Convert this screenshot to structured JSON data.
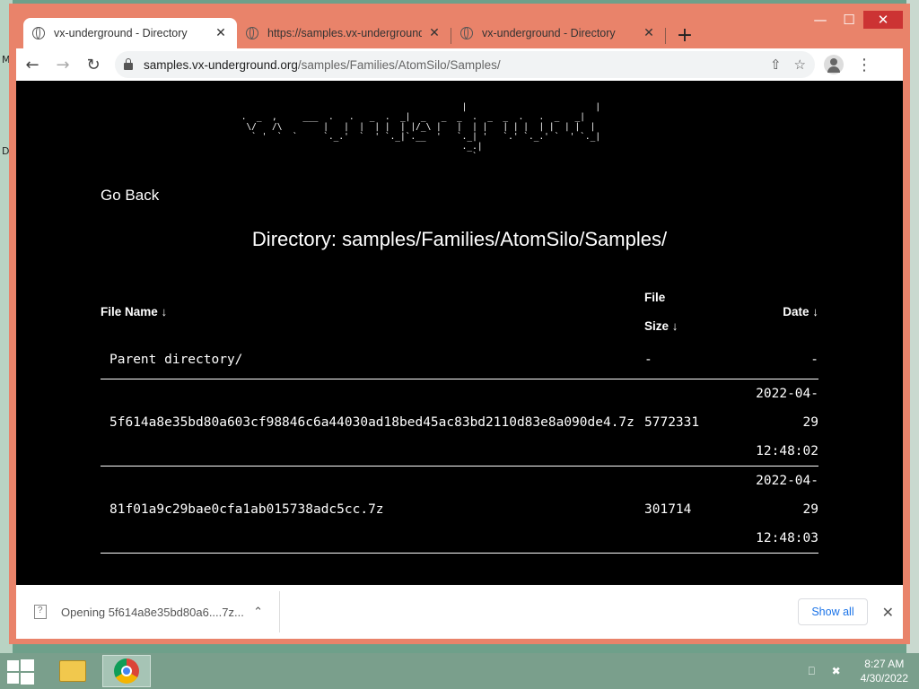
{
  "desktop": {
    "left_glyphs": [
      "M",
      "D"
    ]
  },
  "window_controls": {
    "minimize": "—",
    "maximize": "☐",
    "close": "✕"
  },
  "tabs": [
    {
      "title": "vx-underground - Directory",
      "close": "✕",
      "active": true
    },
    {
      "title": "https://samples.vx-underground.",
      "close": "✕",
      "active": false
    },
    {
      "title": "vx-underground - Directory",
      "close": "✕",
      "active": false
    }
  ],
  "new_tab": "+",
  "toolbar": {
    "back": "←",
    "forward": "→",
    "reload": "↻",
    "url_host": "samples.vx-underground.org",
    "url_path": "/samples/Families/AtomSilo/Samples/",
    "share_icon": "⇧",
    "star_icon": "☆",
    "menu": "⋮"
  },
  "page": {
    "ascii_logo": "                                            |                         |\n .  _  ,     ___  .   .   _  .  _|  _   _  _  .  _  _  .   .  _   _|\n  \\/   /\\        |   |  |  | |  | |/_\\ |   |  | |   | | |  | |  | |  |\n   ` '  `  `     `._.'  `  ' `._|`.__  '   `._| '   `.' `._.' `  ' `._|\n                                            ._.|\n                                              `",
    "go_back": "Go Back",
    "directory_label": "Directory: samples/Families/AtomSilo/Samples/",
    "table": {
      "headers": {
        "name": "File Name  ↓",
        "size_line1": "File",
        "size_line2": "Size  ↓",
        "date": "Date  ↓"
      },
      "parent": {
        "name": "Parent directory/",
        "size": "-",
        "date": "-"
      },
      "rows": [
        {
          "name": "5f614a8e35bd80a603cf98846c6a44030ad18bed45ac83bd2110d83e8a090de4.7z",
          "size": "5772331",
          "date": "2022-04-29",
          "time": "12:48:02"
        },
        {
          "name": "81f01a9c29bae0cfa1ab015738adc5cc.7z",
          "size": "301714",
          "date": "2022-04-29",
          "time": "12:48:03"
        }
      ]
    }
  },
  "download_bar": {
    "item_text": "Opening 5f614a8e35bd80a6....7z...",
    "chevron": "⌃",
    "show_all": "Show all",
    "close": "✕"
  },
  "taskbar": {
    "time": "8:27 AM",
    "date": "4/30/2022",
    "network_icon": "⎕",
    "volume_icon": "✖"
  }
}
